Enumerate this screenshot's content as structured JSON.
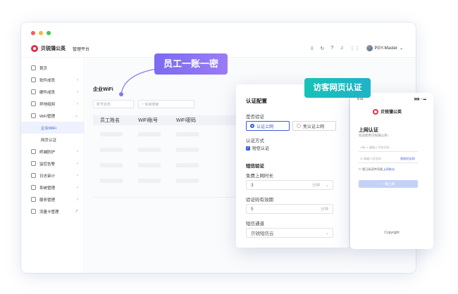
{
  "app": {
    "logo_text": "贝锐蒲公英",
    "subtitle": "管理平台",
    "user_name": "PGY-Master",
    "toolbar_icons": [
      "download-icon",
      "refresh-icon",
      "help-icon",
      "bell-icon",
      "apps-grid-icon"
    ]
  },
  "sidebar": {
    "items": [
      {
        "label": "首页",
        "icon": "home-icon",
        "has_arrow": false
      },
      {
        "label": "软件成员",
        "icon": "user-icon",
        "has_arrow": true
      },
      {
        "label": "硬件成员",
        "icon": "device-icon",
        "has_arrow": true
      },
      {
        "label": "异地组网",
        "icon": "network-icon",
        "has_arrow": true
      },
      {
        "label": "WiFi管理",
        "icon": "wifi-icon",
        "has_arrow": true,
        "expanded": true
      },
      {
        "label": "企业WiFi",
        "sub": true,
        "active": true
      },
      {
        "label": "网页认证",
        "sub": true
      },
      {
        "label": "终端防护",
        "icon": "shield-icon",
        "has_arrow": true
      },
      {
        "label": "监控告警",
        "icon": "alarm-icon",
        "has_arrow": true
      },
      {
        "label": "日志审计",
        "icon": "log-icon",
        "has_arrow": true
      },
      {
        "label": "系统管理",
        "icon": "settings-icon",
        "has_arrow": true
      },
      {
        "label": "服务管理",
        "icon": "service-icon",
        "has_arrow": true
      },
      {
        "label": "流量卡管理",
        "icon": "card-icon",
        "has_arrow": false,
        "external": true
      }
    ]
  },
  "main": {
    "title": "企业WiFi",
    "filter_placeholder": "账号状态",
    "search_placeholder": "快速搜索",
    "columns": [
      "员工姓名",
      "WiFi账号",
      "WiFi密码"
    ]
  },
  "callouts": {
    "one_account": "员工一账一密",
    "visitor_auth": "访客网页认证"
  },
  "auth_panel": {
    "title": "认证配置",
    "verify_label": "是否验证",
    "option_verify": "认证上网",
    "option_free": "免认证上网",
    "method_label": "认证方式",
    "sms_check": "短信认证",
    "sms_section": "短信验证",
    "free_duration_label": "免费上网时长",
    "free_duration_value": "3",
    "free_duration_unit": "分钟",
    "code_expiry_label": "验证码有效期",
    "code_expiry_value": "5",
    "code_expiry_unit": "分钟",
    "channel_label": "短信通道",
    "channel_value": "贝锐短信云"
  },
  "phone": {
    "time": "9:41",
    "signal": "▮▮▮ ◔ ▬",
    "logo_text": "贝锐蒲公英",
    "title": "上网认证",
    "welcome": "欢迎使用贝锐蒲公英!",
    "phone_placeholder": "+86 ∨  请输入手机号码",
    "code_placeholder": "请输入验证码",
    "get_code": "获取验证码",
    "agree_prefix": "我已阅读并同意",
    "agree_link": "上网协议",
    "submit": "一键上网",
    "copyright": "Copyright"
  },
  "colors": {
    "accent": "#3b5bdb",
    "callout_purple": "#8a74f2",
    "callout_teal": "#18bdbd",
    "brand_red": "#e0314b"
  }
}
